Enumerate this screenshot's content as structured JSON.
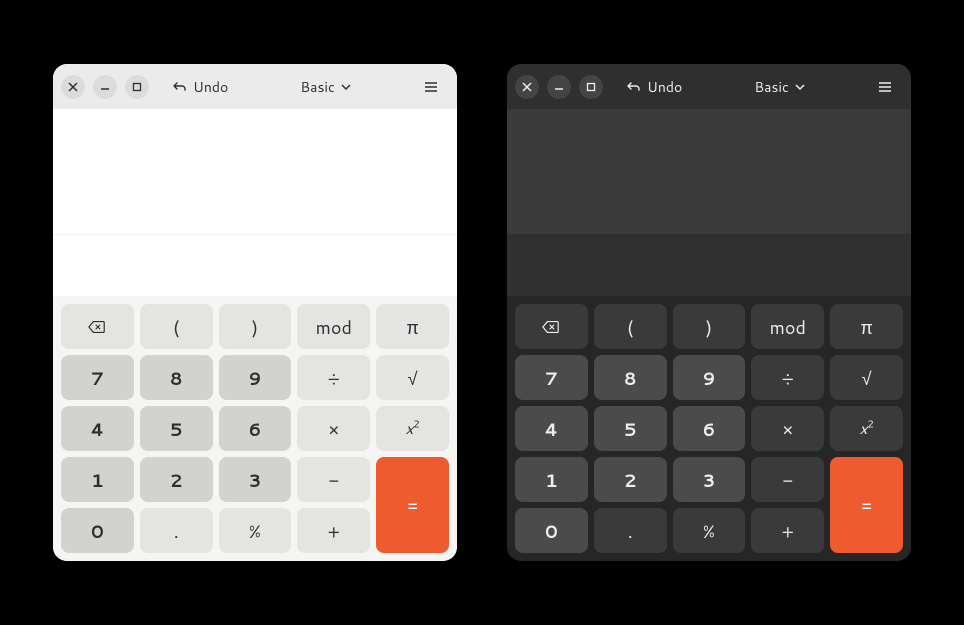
{
  "header": {
    "undo_label": "Undo",
    "mode_label": "Basic"
  },
  "keys": {
    "backspace": "⌫",
    "lparen": "(",
    "rparen": ")",
    "mod": "mod",
    "pi": "π",
    "seven": "7",
    "eight": "8",
    "nine": "9",
    "divide": "÷",
    "sqrt": "√",
    "four": "4",
    "five": "5",
    "six": "6",
    "multiply": "×",
    "xsq_base": "x",
    "xsq_exp": "2",
    "one": "1",
    "two": "2",
    "three": "3",
    "minus": "−",
    "equals": "=",
    "zero": "0",
    "dot": ".",
    "percent": "%",
    "plus": "+"
  },
  "colors": {
    "accent": "#ed5b2e"
  }
}
